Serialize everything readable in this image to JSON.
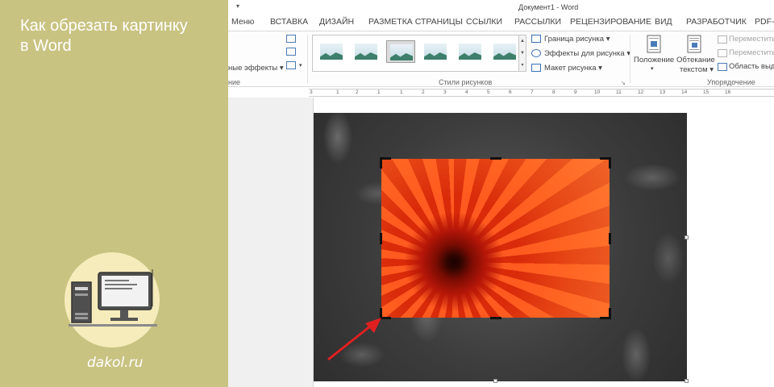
{
  "banner": {
    "title_line1": "Как обрезать картинку",
    "title_line2": "в Word",
    "site": "dakol.ru",
    "logo_icon": "computer-desk-icon"
  },
  "window": {
    "qat_symbol": "▾",
    "title": "Документ1 - Word"
  },
  "tabs": [
    "Меню",
    "ВСТАВКА",
    "ДИЗАЙН",
    "РАЗМЕТКА СТРАНИЦЫ",
    "ССЫЛКИ",
    "РАССЫЛКИ",
    "РЕЦЕНЗИРОВАНИЕ",
    "ВИД",
    "РАЗРАБОТЧИК",
    "PDF-X"
  ],
  "ribbon": {
    "effects_partial": "ные эффекты",
    "left_group_partial": "ние",
    "picture_border": "Граница рисунка",
    "picture_effects": "Эффекты для рисунка",
    "picture_layout": "Макет рисунка",
    "styles_group": "Стили рисунков",
    "position": "Положение",
    "wrap_text_1": "Обтекание",
    "wrap_text_2": "текстом",
    "bring_forward": "Переместить",
    "send_backward": "Переместить",
    "selection_pane": "Область выде",
    "arrange_group": "Упорядочение"
  },
  "ruler": [
    "3",
    "1",
    "2",
    "1",
    "1",
    "2",
    "3",
    "4",
    "5",
    "6",
    "7",
    "8",
    "9",
    "10",
    "11",
    "12",
    "13",
    "14",
    "15",
    "16"
  ],
  "colors": {
    "banner_bg": "#c9c382",
    "logo_circle": "#f6ecbb",
    "arrow": "#e02020",
    "ribbon_icon": "#4a7bb7"
  }
}
